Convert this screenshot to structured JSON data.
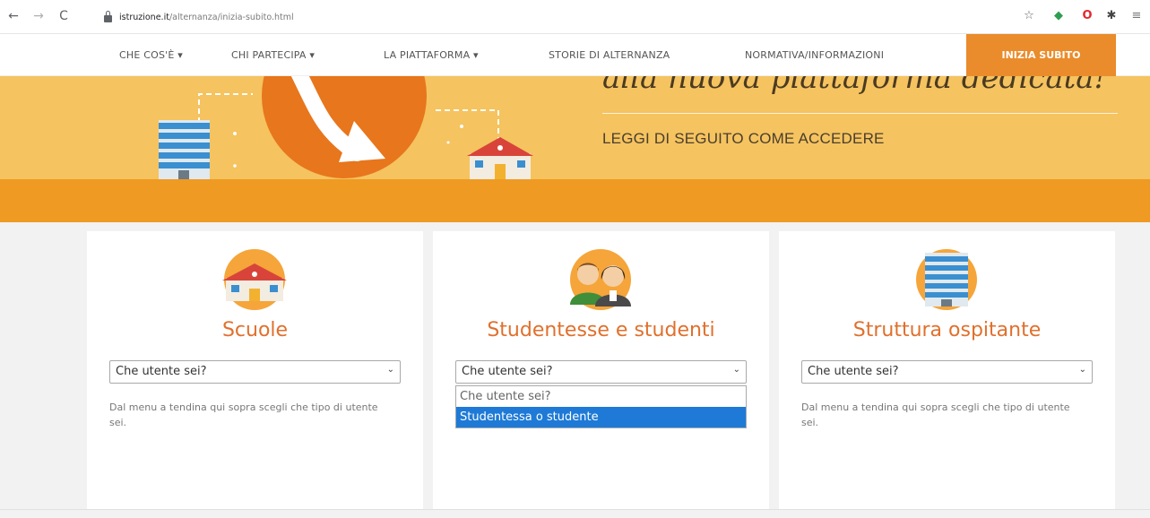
{
  "browser": {
    "nav": {
      "back": "←",
      "forward": "→",
      "reload": "C"
    },
    "url_host": "istruzione.it",
    "url_path": "/alternanza/inizia-subito.html",
    "extensions": [
      "☆",
      "◆",
      "O",
      "✱",
      "≡"
    ]
  },
  "site_nav": {
    "items": [
      "CHE COS'È ▾",
      "CHI PARTECIPA ▾",
      "LA PIATTAFORMA ▾",
      "STORIE DI ALTERNANZA",
      "NORMATIVA/INFORMAZIONI"
    ],
    "cta": "INIZIA SUBITO"
  },
  "hero": {
    "title": "alla nuova piattaforma dedicata!",
    "subtitle": "LEGGI DI SEGUITO COME ACCEDERE"
  },
  "cards": [
    {
      "title": "Scuole",
      "select_value": "Che utente sei?",
      "helper": "Dal menu a tendina qui sopra scegli che tipo di utente sei."
    },
    {
      "title": "Studentesse e studenti",
      "select_value": "Che utente sei?",
      "dropdown_options": [
        "Che utente sei?",
        "Studentessa o studente"
      ]
    },
    {
      "title": "Struttura ospitante",
      "select_value": "Che utente sei?",
      "helper": "Dal menu a tendina qui sopra scegli che tipo di utente sei."
    }
  ],
  "colors": {
    "accent_orange": "#ea8c2b",
    "hero_yellow": "#f5c35f",
    "title_orange": "#e0702c",
    "selected_blue": "#1e7ad6"
  }
}
